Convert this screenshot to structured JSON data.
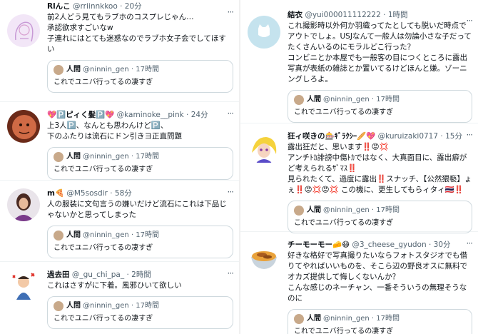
{
  "colors": {
    "text": "#0f1419",
    "muted": "#536471",
    "border": "#cfd9de",
    "divider": "#eff3f4"
  },
  "quote": {
    "name": "人間",
    "handle": "@ninnin_gen",
    "time": "17時間",
    "text": "これでユニバ行ってるの凄すぎ"
  },
  "left": [
    {
      "name": "Rlんこ",
      "handle": "@rriinnkkoo",
      "time": "20分",
      "text": "前2人どう見てもラブホのコスプレじゃん…\n承認欲求すごいなw\n子連れにはとても迷惑なのでラブホ女子会でしてほすい",
      "avatar": "girl-sketch"
    },
    {
      "name": "💖🅿️ピィく髪🅿️💖",
      "handle": "@kaminoke__pink",
      "time": "24分",
      "text": "上3人🅿️、なんとも思わんけど🅿️、\n下のふたりは流石にドン引きヨ正直問題",
      "avatar": "face-photo"
    },
    {
      "name": "m🍕",
      "handle": "@M5sosdir",
      "time": "58分",
      "text": "人の服装に文句言うの嫌いだけど流石にこれは下品じゃないかと思ってしまった",
      "avatar": "woman-photo"
    },
    {
      "name": "過去田",
      "handle": "@_gu_chi_pa_",
      "time": "2時間",
      "text": "これはさすがに下着。風邪ひいて欲しい",
      "avatar": "angry-man"
    }
  ],
  "right": [
    {
      "name": "結衣",
      "handle": "@yui000011112222",
      "time": "1時間",
      "text": "これ撮影時以外何か羽織ってたとしても脱いだ時点でアウトでしょ。USJなんて一般人は勿論小さな子だってたくさんいるのにモラルどこ行った？\nコンビニとか本屋でも一般客の目につくところに露出写真が表紙の雑誌とか置いてるけどほんと嫌。ゾーニングしろよ。",
      "avatar": "default-cat"
    },
    {
      "name": "狂ィ咲きの🎰ｷﾞﾗｸｼｰ🥖💖",
      "handle": "@kuruizaki0717",
      "time": "15分",
      "text": "露出狂だと、思います‼️😡💢\nアンチﾄｶ誹謗中傷ﾄｶではなく、大真面目に、露出癖がど考えられるｻﾞﾏｽ‼️\n見られたくて、過度に露出‼️スナッチ、【公然猥褻】ょぇ‼️😡💢😡💢 この機に、更生してもらィタィ🇹🇭‼️",
      "avatar": "cartoon-girl"
    },
    {
      "name": "チーモーモー🧀😷",
      "handle": "@3_cheese_gyudon",
      "time": "30分",
      "text": "好きな格好で写真撮りたいならフォトスタジオでも借りてやればいいものを、そこら辺の野良オスに無料でオカズ提供して悔しくないんか？\nこんな感じのネーチャン、一番そういうの無理そうなのに",
      "avatar": "gyudon-bowl"
    }
  ]
}
